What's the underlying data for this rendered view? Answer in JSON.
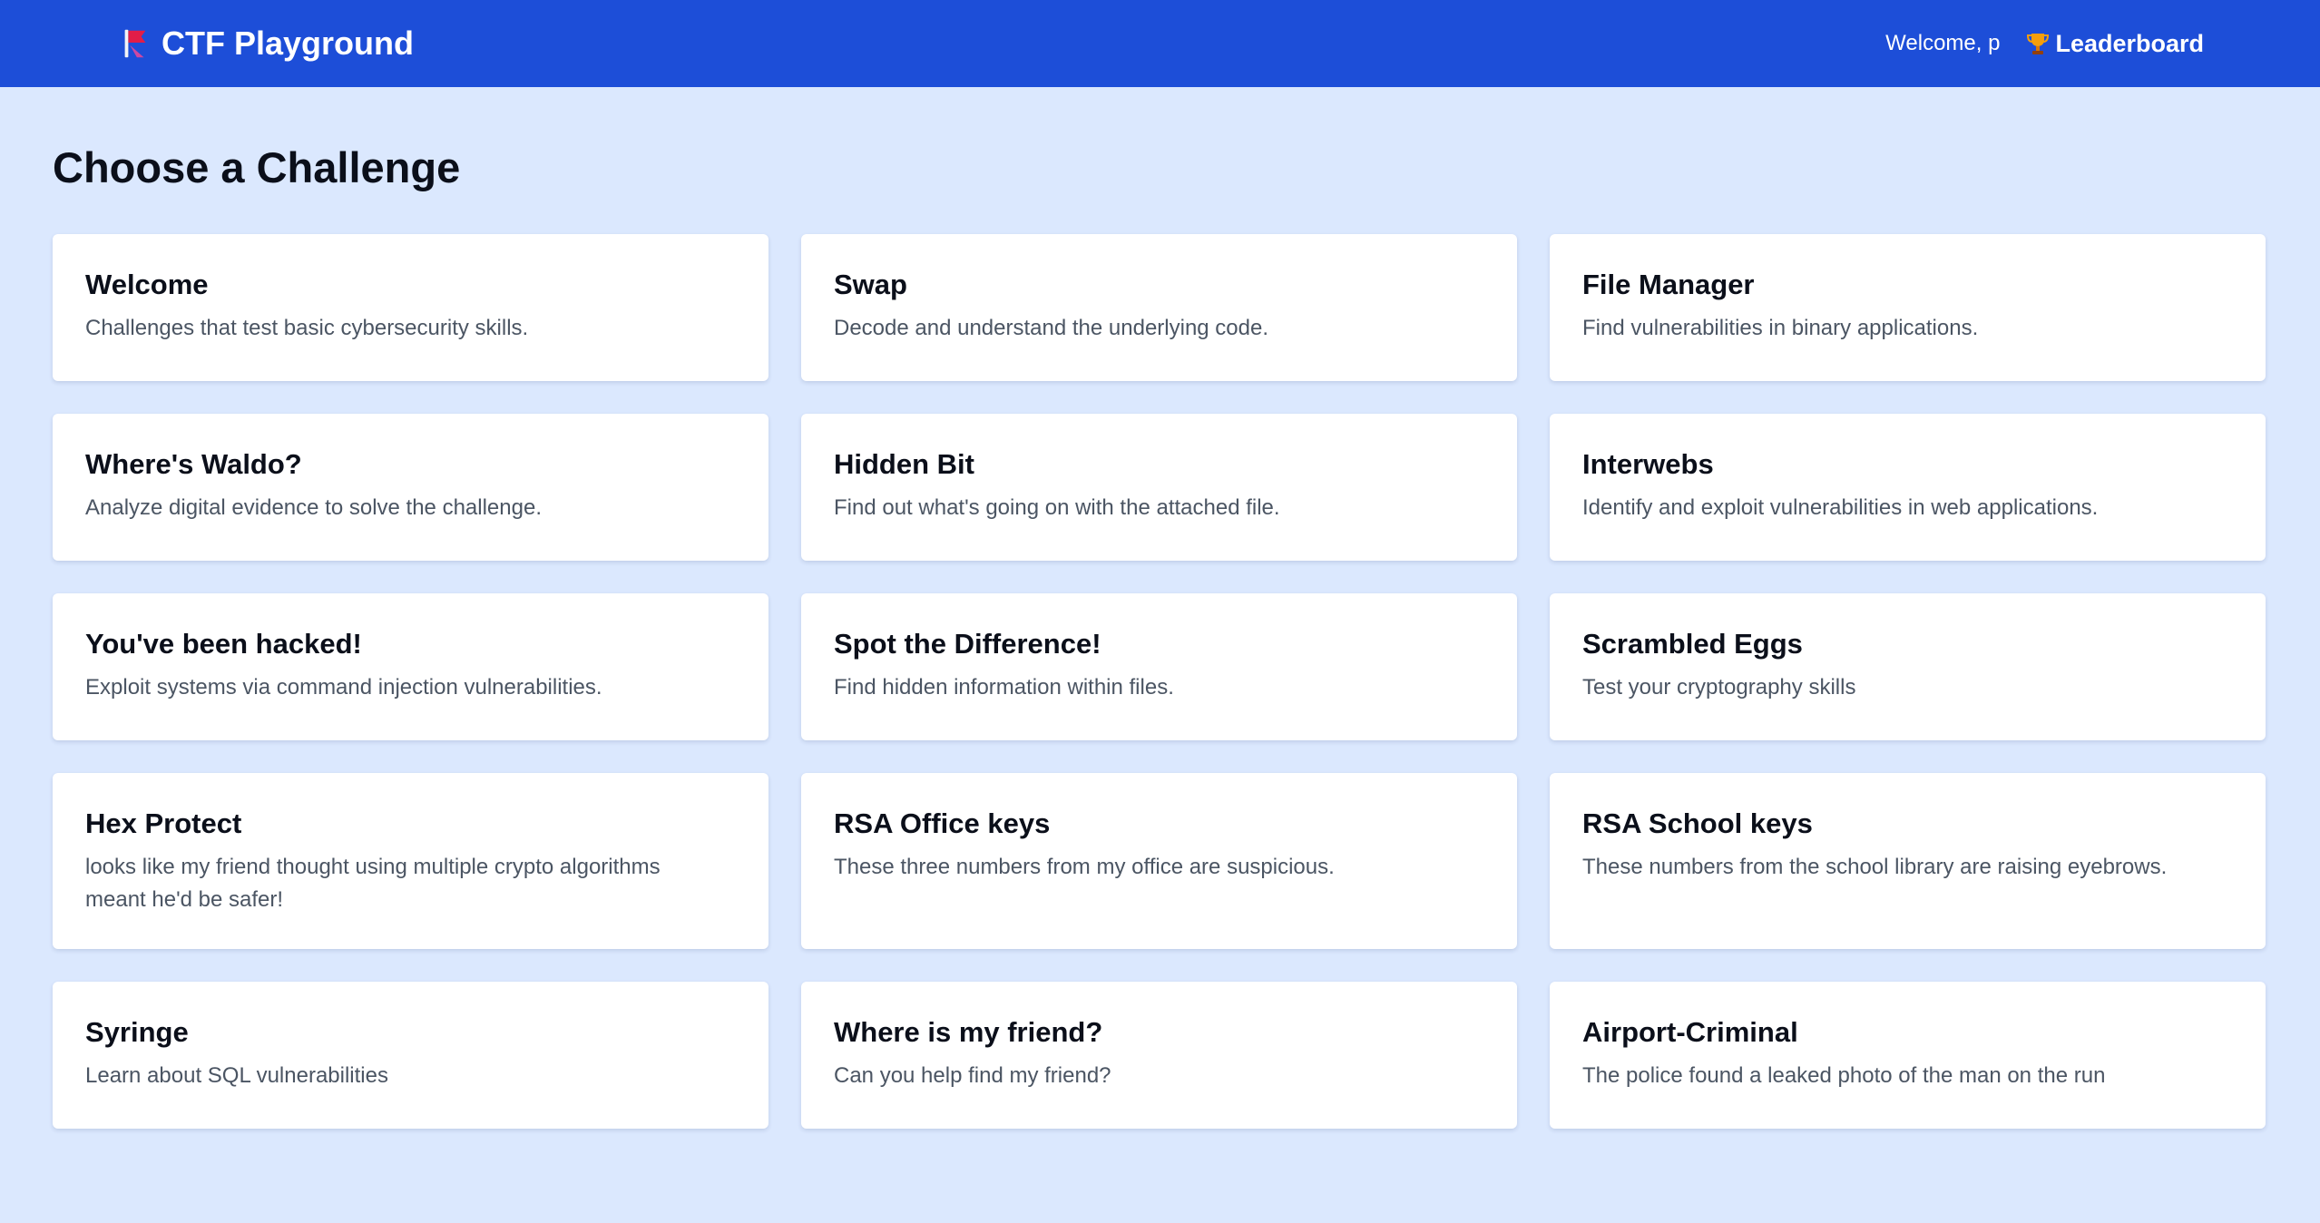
{
  "navbar": {
    "brand_title": "CTF Playground",
    "brand_icon": "flag-icon",
    "welcome_text": "Welcome, p",
    "leaderboard_label": "Leaderboard",
    "leaderboard_icon": "trophy-icon",
    "accent_color": "#1d4ed8"
  },
  "main": {
    "title": "Choose a Challenge",
    "background_color": "#dbe8fe",
    "challenges": [
      {
        "title": "Welcome",
        "description": "Challenges that test basic cybersecurity skills."
      },
      {
        "title": "Swap",
        "description": "Decode and understand the underlying code."
      },
      {
        "title": "File Manager",
        "description": "Find vulnerabilities in binary applications."
      },
      {
        "title": "Where's Waldo?",
        "description": "Analyze digital evidence to solve the challenge."
      },
      {
        "title": "Hidden Bit",
        "description": "Find out what's going on with the attached file."
      },
      {
        "title": "Interwebs",
        "description": "Identify and exploit vulnerabilities in web applications."
      },
      {
        "title": "You've been hacked!",
        "description": "Exploit systems via command injection vulnerabilities."
      },
      {
        "title": "Spot the Difference!",
        "description": "Find hidden information within files."
      },
      {
        "title": "Scrambled Eggs",
        "description": "Test your cryptography skills"
      },
      {
        "title": "Hex Protect",
        "description": "looks like my friend thought using multiple crypto algorithms meant he'd be safer!"
      },
      {
        "title": "RSA Office keys",
        "description": "These three numbers from my office are suspicious."
      },
      {
        "title": "RSA School keys",
        "description": "These numbers from the school library are raising eyebrows."
      },
      {
        "title": "Syringe",
        "description": "Learn about SQL vulnerabilities"
      },
      {
        "title": "Where is my friend?",
        "description": "Can you help find my friend?"
      },
      {
        "title": "Airport-Criminal",
        "description": "The police found a leaked photo of the man on the run"
      }
    ]
  }
}
